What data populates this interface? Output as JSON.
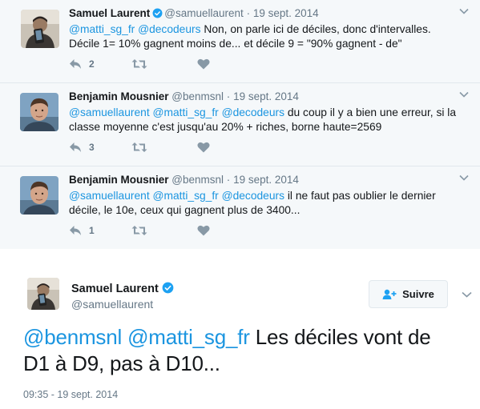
{
  "conversation": [
    {
      "name": "Samuel Laurent",
      "verified": true,
      "handle": "@samuellaurent",
      "dot": "·",
      "date": "19 sept. 2014",
      "mentions": "@matti_sg_fr @decodeurs",
      "text_line1": " Non, on parle ici de déciles, donc d'intervalles.",
      "text_line2": "Décile 1= 10% gagnent moins de... et décile 9 = \"90% gagnent - de\"",
      "reply_count": "2",
      "retweet_count": "",
      "like_count": ""
    },
    {
      "name": "Benjamin Mousnier",
      "verified": false,
      "handle": "@benmsnl",
      "dot": "·",
      "date": "19 sept. 2014",
      "mentions": "@samuellaurent @matti_sg_fr @decodeurs",
      "text_line1": " du coup il y a bien une erreur, si la",
      "text_line2": "classe moyenne c'est jusqu'au 20% + riches, borne haute=2569",
      "reply_count": "3",
      "retweet_count": "",
      "like_count": ""
    },
    {
      "name": "Benjamin Mousnier",
      "verified": false,
      "handle": "@benmsnl",
      "dot": "·",
      "date": "19 sept. 2014",
      "mentions": "@samuellaurent @matti_sg_fr @decodeurs",
      "text_line1": " il ne faut pas oublier le dernier",
      "text_line2": "décile, le 10e, ceux qui gagnent plus de 3400...",
      "reply_count": "1",
      "retweet_count": "",
      "like_count": ""
    }
  ],
  "main_tweet": {
    "name": "Samuel Laurent",
    "verified": true,
    "handle": "@samuellaurent",
    "follow_label": "Suivre",
    "mention1": "@benmsnl",
    "mention2": "@matti_sg_fr",
    "text_after_mentions": " Les déciles vont de",
    "text_line2": "D1 à D9, pas à D10...",
    "timestamp": "09:35 - 19 sept. 2014"
  },
  "colors": {
    "link": "#1b95e0",
    "verified": "#1da1f2",
    "secondary_text": "#657786",
    "conversation_bg": "#f5f8fa"
  },
  "icons": [
    "reply-icon",
    "retweet-icon",
    "like-icon",
    "chevron-down-icon",
    "verified-badge-icon",
    "follow-person-icon"
  ]
}
